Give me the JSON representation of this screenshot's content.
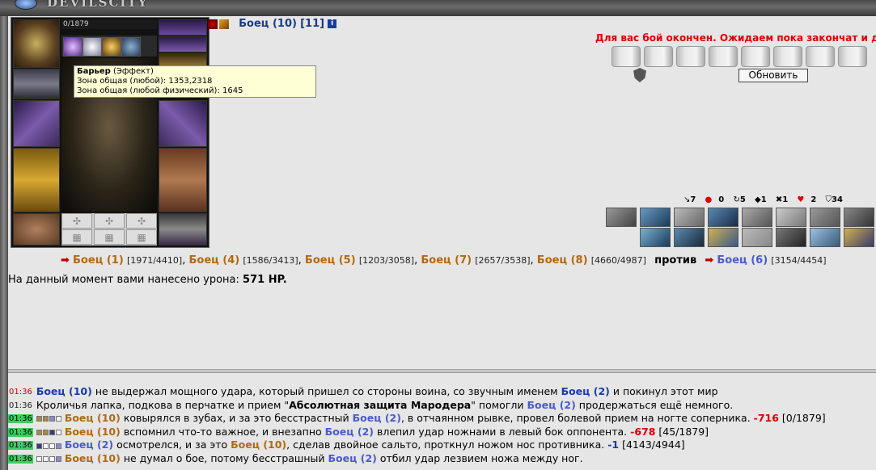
{
  "app": {
    "logo": "DEVILSCITY"
  },
  "character": {
    "hp": "0/1879"
  },
  "tooltip": {
    "title": "Барьер",
    "title_suffix": " (Эффект)",
    "line1": "Зона общая (любой): 1353,2318",
    "line2": "Зона общая (любой физический): 1645"
  },
  "opponent": {
    "name": "Боец (10)",
    "level": "[11]",
    "info": "i"
  },
  "status": {
    "message": "Для вас бой окончен. Ожидаем пока закончат и др",
    "refresh_label": "Обновить"
  },
  "stats": [
    "7",
    "0",
    "5",
    "1",
    "1",
    "2",
    "34"
  ],
  "teams": {
    "left": [
      {
        "name": "Боец (1)",
        "hp": "[1971/4410]"
      },
      {
        "name": "Боец (4)",
        "hp": "[1586/3413]"
      },
      {
        "name": "Боец (5)",
        "hp": "[1203/3058]"
      },
      {
        "name": "Боец (7)",
        "hp": "[2657/3538]"
      },
      {
        "name": "Боец (8)",
        "hp": "[4660/4987]"
      }
    ],
    "versus": "против",
    "right": [
      {
        "name": "Боец (6)",
        "hp": "[3154/4454]"
      }
    ]
  },
  "damage": {
    "label": "На данный момент вами нанесено урона: ",
    "value": "571 HP."
  },
  "log": [
    {
      "time": "01:36",
      "style": "red",
      "parts": [
        {
          "t": "Боец (10)",
          "c": "heal"
        },
        {
          "t": " не выдержал мощного удара, который пришел со стороны воина, со звучным именем "
        },
        {
          "t": "Боец (2)",
          "c": "heal"
        },
        {
          "t": " и покинул этот мир"
        }
      ]
    },
    {
      "time": "01:36",
      "style": "plain",
      "parts": [
        {
          "t": "Кроличья лапка, подкова в перчатке и прием \""
        },
        {
          "t": "Абсолютная защита Мародера",
          "c": "bold"
        },
        {
          "t": "\" помогли "
        },
        {
          "t": "Боец (2)",
          "c": "nm-b"
        },
        {
          "t": " продержаться ещё немного."
        }
      ]
    },
    {
      "time": "01:36",
      "style": "hl",
      "blocks": [
        "b-f",
        "b-f",
        "b-p",
        "b-w"
      ],
      "parts": [
        {
          "t": "Боец (10)",
          "c": "nm-o"
        },
        {
          "t": " ковырялся в зубах, и за это бесстрастный "
        },
        {
          "t": "Боец (2)",
          "c": "nm-b"
        },
        {
          "t": ", в отчаянном рывке, провел болевой прием на ногте соперника. "
        },
        {
          "t": "-716",
          "c": "dmg"
        },
        {
          "t": " [0/1879]"
        }
      ]
    },
    {
      "time": "01:36",
      "style": "hl",
      "blocks": [
        "b-f",
        "b-f",
        "b-d",
        "b-w"
      ],
      "parts": [
        {
          "t": "Боец (10)",
          "c": "nm-o"
        },
        {
          "t": " вспомнил что-то важное, и внезапно "
        },
        {
          "t": "Боец (2)",
          "c": "nm-b"
        },
        {
          "t": " влепил удар ножнами в левый бок оппонента. "
        },
        {
          "t": "-678",
          "c": "dmg"
        },
        {
          "t": " [45/1879]"
        }
      ]
    },
    {
      "time": "01:36",
      "style": "hl",
      "blocks": [
        "b-d",
        "b-w",
        "b-w",
        "b-p"
      ],
      "parts": [
        {
          "t": "Боец (2)",
          "c": "nm-b"
        },
        {
          "t": " осмотрелся, и за это "
        },
        {
          "t": "Боец (10)",
          "c": "nm-o"
        },
        {
          "t": ", сделав двойное сальто, проткнул ножом нос противника. "
        },
        {
          "t": "-1",
          "c": "heal"
        },
        {
          "t": " [4143/4944]"
        }
      ]
    },
    {
      "time": "01:36",
      "style": "hl",
      "blocks": [
        "b-w",
        "b-w",
        "b-w",
        "b-p"
      ],
      "parts": [
        {
          "t": "Боец (10)",
          "c": "nm-o"
        },
        {
          "t": " не думал о бое, потому бесстрашный "
        },
        {
          "t": "Боец (2)",
          "c": "nm-b"
        },
        {
          "t": " отбил удар лезвием ножа между ног."
        }
      ]
    }
  ]
}
